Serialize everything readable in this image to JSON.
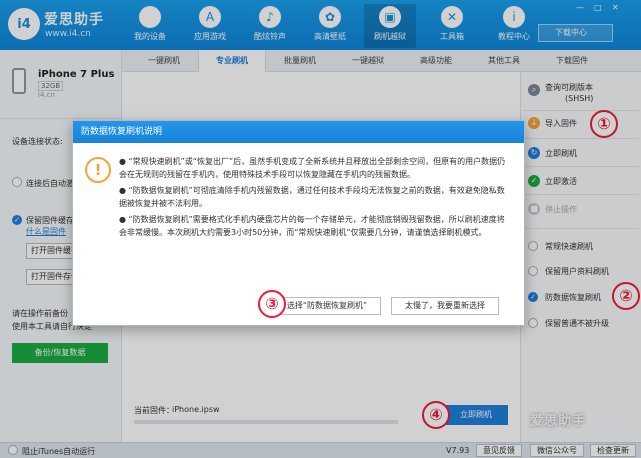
{
  "brand": {
    "name": "爱思助手",
    "url": "www.i4.cn",
    "logo_text": "i4"
  },
  "nav": [
    {
      "label": "我的设备",
      "icon": "apple-icon"
    },
    {
      "label": "应用游戏",
      "icon": "app-store-icon"
    },
    {
      "label": "酷炫铃声",
      "icon": "bell-icon"
    },
    {
      "label": "高清壁纸",
      "icon": "flower-icon"
    },
    {
      "label": "刷机越狱",
      "icon": "box-icon"
    },
    {
      "label": "工具箱",
      "icon": "tools-icon"
    },
    {
      "label": "教程中心",
      "icon": "info-icon"
    }
  ],
  "download_center": "下载中心",
  "device": {
    "name": "iPhone 7 Plus",
    "capacity": "32GB",
    "site": "i4.cn"
  },
  "left": {
    "status_label": "设备连接状态:",
    "auto_activate": "连接后自动激活",
    "keep_firmware": "保留固件缓存",
    "link_text": "什么是固件",
    "open_firmware_dir": "打开固件缓存",
    "open_firmware_folder": "打开固件存储",
    "hint_line1": "请在操作前备份",
    "hint_line2": "使用本工具请自行决定",
    "backup_button": "备份/恢复数据"
  },
  "tabs": [
    "一键刷机",
    "专业刷机",
    "批量刷机",
    "一键越狱",
    "高级功能",
    "其他工具",
    "下载固件"
  ],
  "active_tab": 1,
  "right": {
    "query_shsh_line1": "查询可刷版本",
    "query_shsh_line2": "(SHSH)",
    "import_firmware": "导入固件",
    "flash_now": "立即刷机",
    "activate_now": "立即激活",
    "stop": "停止操作",
    "options": [
      "常规快速刷机",
      "保留用户资料刷机",
      "防数据恢复刷机",
      "保留普通不被升级"
    ],
    "selected_option": 2
  },
  "markers": [
    "①",
    "②",
    "③",
    "④"
  ],
  "current_firmware_label": "当前固件：",
  "current_firmware_value": "iPhone.ipsw",
  "flash_button": "立即刷机",
  "watermark": "爱思助手",
  "bottom": {
    "block_itunes": "阻止iTunes自动运行",
    "version": "V7.93",
    "feedback": "意见反馈",
    "wechat": "微信公众号",
    "update": "检查更新"
  },
  "dialog": {
    "title": "防数据恢复刷机说明",
    "para1": "● “常规快速刷机”或“恢复出厂”后，虽然手机变成了全新系统并且释放出全部剩余空间，但原有的用户数据仍会在无规则的残留在手机内，使用特殊技术手段可以恢复隐藏在手机内的残留数据。",
    "para2": "● “防数据恢复刷机”可彻底清除手机内残留数据，通过任何技术手段均无法恢复之前的数据，有效避免隐私数据被恢复并被不法利用。",
    "para3": "● “防数据恢复刷机”需要格式化手机内硬盘芯片的每一个存储单元，才能彻底销毁残留数据，所以刷机速度将会非常缓慢。本次刷机大约需要3小时50分钟，而“常规快速刷机”仅需要几分钟，请谨慎选择刷机模式。",
    "confirm": "选择“防数据恢复刷机”",
    "cancel": "太慢了，我要重新选择"
  },
  "colors": {
    "accent": "#1e7fdc",
    "topbar": "#1690e0",
    "green": "#19ac42",
    "marker_red": "#ea1e3a",
    "warning": "#f2a43a"
  }
}
